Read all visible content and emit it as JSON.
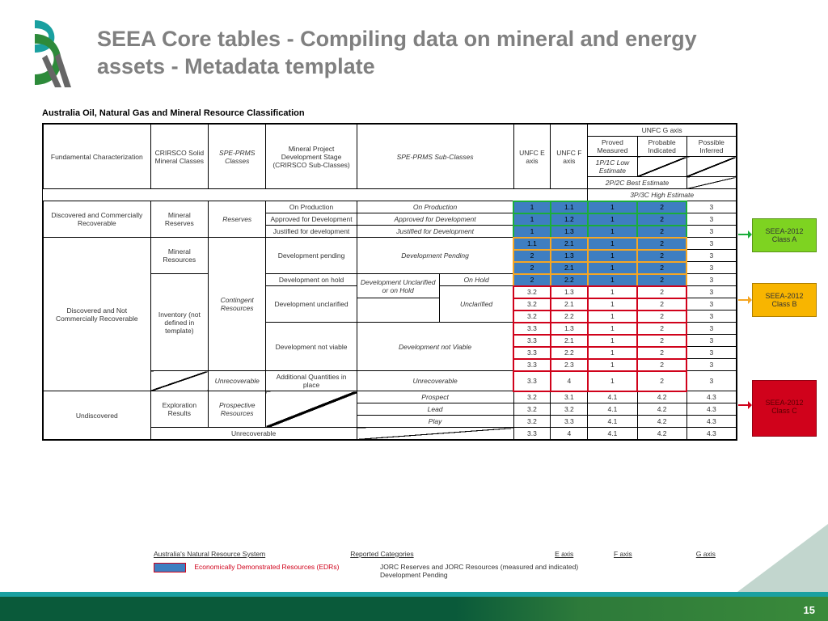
{
  "title": "SEEA Core tables - Compiling data on mineral and energy assets - Metadata template",
  "subtitle": "Australia Oil, Natural Gas and Mineral Resource Classification",
  "pageNumber": "15",
  "headers": {
    "fundamental": "Fundamental Characterization",
    "crirsco": "CRIRSCO Solid Mineral Classes",
    "spe": "SPE-PRMS Classes",
    "stage": "Mineral Project Development Stage (CRIRSCO Sub-Classes)",
    "sub": "SPE-PRMS Sub-Classes",
    "unfcE": "UNFC E axis",
    "unfcF": "UNFC F axis",
    "unfcG": "UNFC G axis",
    "g1": "Proved Measured",
    "g2": "Probable Indicated",
    "g3": "Possible Inferred",
    "est1": "1P/1C Low Estimate",
    "est2": "2P/2C Best Estimate",
    "est3": "3P/3C High Estimate"
  },
  "groups": {
    "discoveredComm": "Discovered and Commercially Recoverable",
    "discoveredNot": "Discovered and Not Commercially Recoverable",
    "undiscovered": "Undiscovered",
    "mineralReserves": "Mineral Reserves",
    "mineralResources": "Mineral Resources",
    "inventory": "Inventory (not defined in template)",
    "exploration": "Exploration Results",
    "reserves": "Reserves",
    "contingent": "Contingent Resources",
    "unrecoverable": "Unrecoverable",
    "prospective": "Prospective Resources",
    "unrecov2": "Unrecoverable"
  },
  "stages": {
    "onProd": "On Production",
    "approved": "Approved for Development",
    "justified": "Justified for development",
    "pending": "Development pending",
    "onHold": "Development on hold",
    "unclarified": "Development unclarified",
    "notViable": "Development not viable",
    "addQty": "Additional Quantities in place"
  },
  "subs": {
    "onProd": "On Production",
    "approved": "Approved for Development",
    "justified": "Justified for Development",
    "pending": "Development Pending",
    "onHold": "On Hold",
    "devUnc": "Development Unclarified or on Hold",
    "unclarified": "Unclarified",
    "notViable": "Development not Viable",
    "unrecov": "Unrecoverable",
    "prospect": "Prospect",
    "lead": "Lead",
    "play": "Play"
  },
  "rows": [
    {
      "e": "1",
      "f": "1.1",
      "g1": "1",
      "g2": "2",
      "g3": "3",
      "hl": "g",
      "key": "onProd"
    },
    {
      "e": "1",
      "f": "1.2",
      "g1": "1",
      "g2": "2",
      "g3": "3",
      "hl": "g",
      "key": "approved"
    },
    {
      "e": "1",
      "f": "1.3",
      "g1": "1",
      "g2": "2",
      "g3": "3",
      "hl": "g",
      "key": "justified"
    },
    {
      "e": "1.1",
      "f": "2.1",
      "g1": "1",
      "g2": "2",
      "g3": "3",
      "hl": "o",
      "key": "p1"
    },
    {
      "e": "2",
      "f": "1.3",
      "g1": "1",
      "g2": "2",
      "g3": "3",
      "hl": "o",
      "key": "p2"
    },
    {
      "e": "2",
      "f": "2.1",
      "g1": "1",
      "g2": "2",
      "g3": "3",
      "hl": "o",
      "key": "p3"
    },
    {
      "e": "2",
      "f": "2.2",
      "g1": "1",
      "g2": "2",
      "g3": "3",
      "hl": "o",
      "key": "hold"
    },
    {
      "e": "3.2",
      "f": "1.3",
      "g1": "1",
      "g2": "2",
      "g3": "3",
      "hl": "r",
      "key": "u1"
    },
    {
      "e": "3.2",
      "f": "2.1",
      "g1": "1",
      "g2": "2",
      "g3": "3",
      "hl": "r",
      "key": "u2"
    },
    {
      "e": "3.2",
      "f": "2.2",
      "g1": "1",
      "g2": "2",
      "g3": "3",
      "hl": "r",
      "key": "u3"
    },
    {
      "e": "3.3",
      "f": "1.3",
      "g1": "1",
      "g2": "2",
      "g3": "3",
      "hl": "r",
      "key": "nv1"
    },
    {
      "e": "3.3",
      "f": "2.1",
      "g1": "1",
      "g2": "2",
      "g3": "3",
      "hl": "r",
      "key": "nv2"
    },
    {
      "e": "3.3",
      "f": "2.2",
      "g1": "1",
      "g2": "2",
      "g3": "3",
      "hl": "r",
      "key": "nv3"
    },
    {
      "e": "3.3",
      "f": "2.3",
      "g1": "1",
      "g2": "2",
      "g3": "3",
      "hl": "r",
      "key": "nv4"
    },
    {
      "e": "3.3",
      "f": "4",
      "g1": "1",
      "g2": "2",
      "g3": "3",
      "hl": "r",
      "key": "addq"
    },
    {
      "e": "3.2",
      "f": "3.1",
      "g1": "4.1",
      "g2": "4.2",
      "g3": "4.3",
      "hl": "",
      "key": "prospect"
    },
    {
      "e": "3.2",
      "f": "3.2",
      "g1": "4.1",
      "g2": "4.2",
      "g3": "4.3",
      "hl": "",
      "key": "lead"
    },
    {
      "e": "3.2",
      "f": "3.3",
      "g1": "4.1",
      "g2": "4.2",
      "g3": "4.3",
      "hl": "",
      "key": "play"
    },
    {
      "e": "3.3",
      "f": "4",
      "g1": "4.1",
      "g2": "4.2",
      "g3": "4.3",
      "hl": "",
      "key": "unrec"
    }
  ],
  "annotations": {
    "classA": "SEEA-2012 Class A",
    "classB": "SEEA-2012 Class B",
    "classC": "SEEA-2012 Class C"
  },
  "legend": {
    "nrs": "Australia's Natural Resource System",
    "rep": "Reported Categories",
    "e": "E axis",
    "f": "F axis",
    "g": "G axis",
    "edr": "Economically Demonstrated Resources (EDRs)",
    "jorc": "JORC Reserves and JORC Resources (measured and indicated) Development Pending"
  }
}
